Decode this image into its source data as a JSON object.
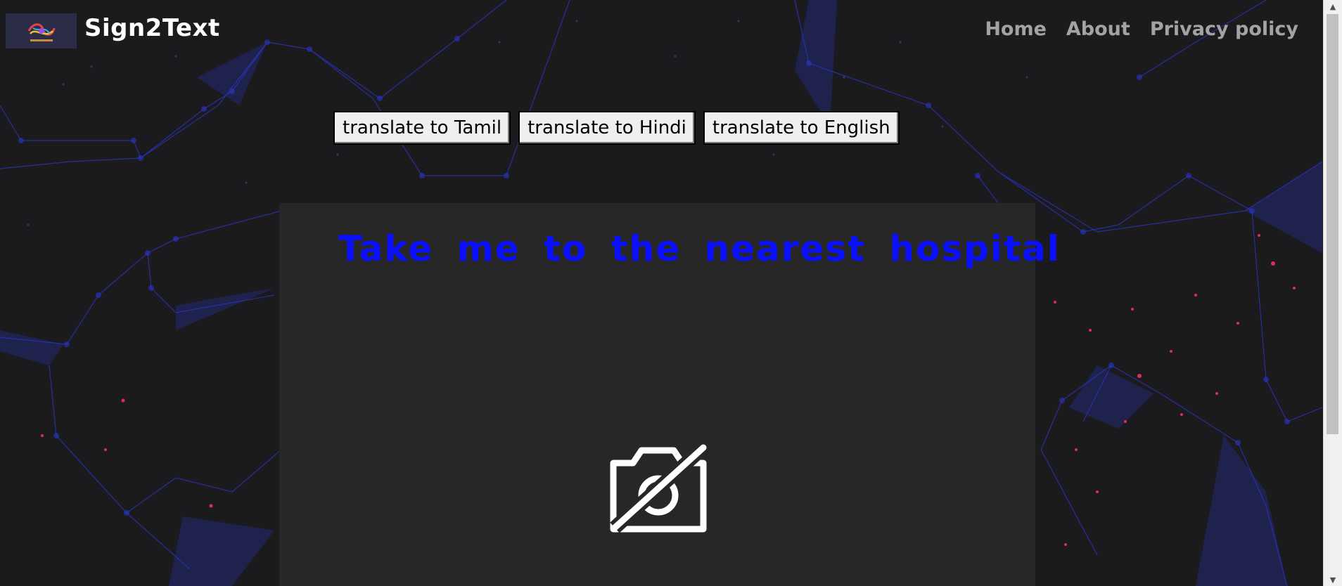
{
  "brand": {
    "name": "Sign2Text",
    "logo_icon": "sign2text-logo"
  },
  "nav": [
    {
      "label": "Home"
    },
    {
      "label": "About"
    },
    {
      "label": "Privacy policy"
    }
  ],
  "translate_buttons": [
    {
      "label": "translate to Tamil"
    },
    {
      "label": "translate to Hindi"
    },
    {
      "label": "translate to English"
    }
  ],
  "output": {
    "text": "Take me to the nearest hospital",
    "color": "#0a10ff"
  },
  "camera": {
    "icon": "camera-off-icon"
  },
  "colors": {
    "background": "#1b1b1e",
    "panel": "#272727",
    "network_lines": "#2a35c8",
    "particles_red": "#ff2f6e"
  }
}
